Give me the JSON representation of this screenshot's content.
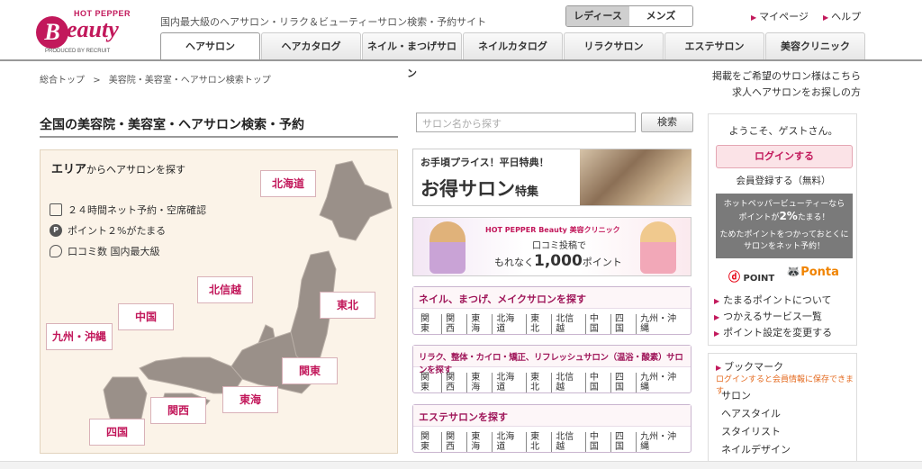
{
  "header": {
    "logo_top": "HOT PEPPER",
    "logo_b": "B",
    "logo_word": "eauty",
    "logo_produced": "PRODUCED BY RECRUIT",
    "tagline": "国内最大級のヘアサロン・リラク＆ビューティーサロン検索・予約サイト",
    "gender_toggle": {
      "ladies": "レディース",
      "mens": "メンズ"
    },
    "mypage": "マイページ",
    "help": "ヘルプ",
    "tabs": [
      "ヘアサロン",
      "ヘアカタログ",
      "ネイル・まつげサロン",
      "ネイルカタログ",
      "リラクサロン",
      "エステサロン",
      "美容クリニック"
    ]
  },
  "breadcrumb": {
    "home": "総合トップ",
    "sep": ">",
    "current": "美容院・美容室・ヘアサロン検索トップ"
  },
  "right_links": {
    "listing": "掲載をご希望のサロン様はこちら",
    "recruit": "求人ヘアサロンをお探しの方"
  },
  "main": {
    "heading": "全国の美容院・美容室・ヘアサロン検索・予約",
    "search_placeholder": "サロン名から探す",
    "search_button": "検索"
  },
  "area_panel": {
    "title_bold": "エリア",
    "title_rest": "からヘアサロンを探す",
    "features": [
      {
        "icon": "monitor-icon",
        "text": "２４時間ネット予約・空席確認"
      },
      {
        "icon": "point-icon",
        "text": "ポイント２%がたまる"
      },
      {
        "icon": "speech-bubble-icon",
        "text": "口コミ数 国内最大級"
      }
    ],
    "regions": {
      "hokkaido": "北海道",
      "tohoku": "東北",
      "hokushinetsu": "北信越",
      "chugoku": "中国",
      "kyushu": "九州・沖縄",
      "kanto": "関東",
      "tokai": "東海",
      "kansai": "関西",
      "shikoku": "四国"
    }
  },
  "banners": {
    "b1_top": "お手頃プライス！平日特典！",
    "b1_big": "お得サロン",
    "b1_small": "特集",
    "b2_brand": "HOT PEPPER Beauty 美容クリニック",
    "b2_line1": "口コミ投稿で",
    "b2_line2_pre": "もれなく",
    "b2_line2_num": "1,000",
    "b2_line2_post": "ポイント"
  },
  "categories": [
    {
      "title": "ネイル、まつげ、メイクサロンを探す",
      "regions": [
        "関東",
        "関西",
        "東海",
        "北海道",
        "東北",
        "北信越",
        "中国",
        "四国",
        "九州・沖縄"
      ]
    },
    {
      "title": "リラク、整体・カイロ・矯正、リフレッシュサロン（温浴・酸素）サロンを探す",
      "regions": [
        "関東",
        "関西",
        "東海",
        "北海道",
        "東北",
        "北信越",
        "中国",
        "四国",
        "九州・沖縄"
      ]
    },
    {
      "title": "エステサロンを探す",
      "regions": [
        "関東",
        "関西",
        "東海",
        "北海道",
        "東北",
        "北信越",
        "中国",
        "四国",
        "九州・沖縄"
      ]
    }
  ],
  "sidebar": {
    "welcome": "ようこそ、ゲストさん。",
    "login": "ログインする",
    "register": "会員登録する（無料）",
    "points_line1": "ホットペッパービューティーなら",
    "points_line2_pre": "ポイントが",
    "points_line2_num": "2%",
    "points_line2_post": "たまる！",
    "points_line3": "ためたポイントをつかっておとくに",
    "points_line4": "サロンをネット予約！",
    "dpoint": "POINT",
    "ponta": "Ponta",
    "links": [
      "たまるポイントについて",
      "つかえるサービス一覧",
      "ポイント設定を変更する"
    ]
  },
  "bookmark": {
    "title": "ブックマーク",
    "note": "ログインすると会員情報に保存できます",
    "items": [
      "サロン",
      "ヘアスタイル",
      "スタイリスト",
      "ネイルデザイン"
    ]
  },
  "colors": {
    "brand": "#c2185b",
    "region_text": "#c2185b",
    "map_fill": "#9a9089",
    "panel_bg": "#fbf3e8"
  }
}
